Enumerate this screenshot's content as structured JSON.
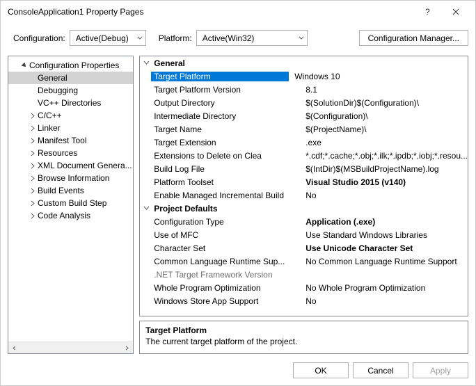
{
  "window": {
    "title": "ConsoleApplication1 Property Pages"
  },
  "configRow": {
    "configLabel": "Configuration:",
    "configValue": "Active(Debug)",
    "platformLabel": "Platform:",
    "platformValue": "Active(Win32)",
    "managerButton": "Configuration Manager..."
  },
  "tree": {
    "root": "Configuration Properties",
    "items": [
      {
        "label": "General",
        "selected": true,
        "expandable": false
      },
      {
        "label": "Debugging",
        "expandable": false
      },
      {
        "label": "VC++ Directories",
        "expandable": false
      },
      {
        "label": "C/C++",
        "expandable": true
      },
      {
        "label": "Linker",
        "expandable": true
      },
      {
        "label": "Manifest Tool",
        "expandable": true
      },
      {
        "label": "Resources",
        "expandable": true
      },
      {
        "label": "XML Document Genera...",
        "expandable": true
      },
      {
        "label": "Browse Information",
        "expandable": true
      },
      {
        "label": "Build Events",
        "expandable": true
      },
      {
        "label": "Custom Build Step",
        "expandable": true
      },
      {
        "label": "Code Analysis",
        "expandable": true
      }
    ]
  },
  "grid": {
    "group1": "General",
    "props1": [
      {
        "name": "Target Platform",
        "value": "Windows 10",
        "selected": true
      },
      {
        "name": "Target Platform Version",
        "value": "8.1"
      },
      {
        "name": "Output Directory",
        "value": "$(SolutionDir)$(Configuration)\\"
      },
      {
        "name": "Intermediate Directory",
        "value": "$(Configuration)\\"
      },
      {
        "name": "Target Name",
        "value": "$(ProjectName)\\"
      },
      {
        "name": "Target Extension",
        "value": ".exe"
      },
      {
        "name": "Extensions to Delete on Clea",
        "value": "*.cdf;*.cache;*.obj;*.ilk;*.ipdb;*.iobj;*.resou..."
      },
      {
        "name": "Build Log File",
        "value": "$(IntDir)$(MSBuildProjectName).log"
      },
      {
        "name": "Platform Toolset",
        "value": "Visual Studio 2015 (v140)",
        "bold": true
      },
      {
        "name": "Enable Managed Incremental Build",
        "value": "No"
      }
    ],
    "group2": "Project Defaults",
    "props2": [
      {
        "name": "Configuration Type",
        "value": "Application (.exe)",
        "bold": true
      },
      {
        "name": "Use of MFC",
        "value": "Use Standard Windows Libraries"
      },
      {
        "name": "Character Set",
        "value": "Use Unicode Character Set",
        "bold": true
      },
      {
        "name": "Common Language Runtime Sup...",
        "value": "No Common Language Runtime Support"
      },
      {
        "name": ".NET Target Framework Version",
        "value": "",
        "disabled": true
      },
      {
        "name": "Whole Program Optimization",
        "value": "No Whole Program Optimization"
      },
      {
        "name": "Windows Store App Support",
        "value": "No"
      }
    ]
  },
  "description": {
    "title": "Target Platform",
    "text": "The current target platform of the project."
  },
  "footer": {
    "ok": "OK",
    "cancel": "Cancel",
    "apply": "Apply"
  }
}
